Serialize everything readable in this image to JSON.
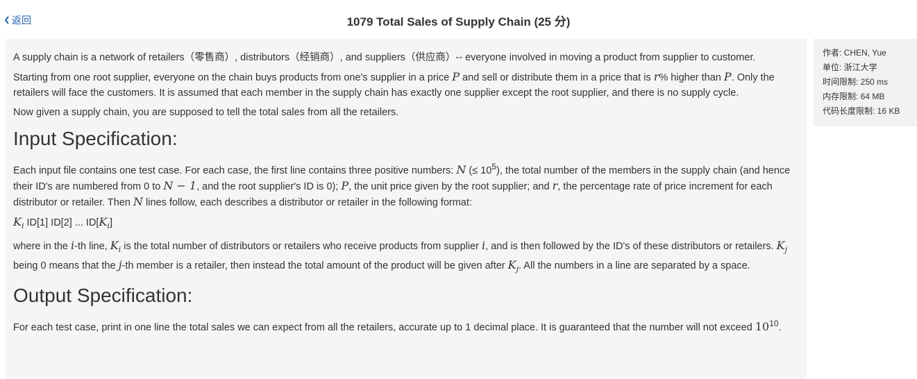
{
  "nav": {
    "back_label": "返回"
  },
  "page_title": "1079 Total Sales of Supply Chain (25 分)",
  "info": {
    "author": "作者: CHEN, Yue",
    "unit": "单位: 浙江大学",
    "time_limit": "时间限制: 250 ms",
    "memory_limit": "内存限制: 64 MB",
    "code_limit": "代码长度限制: 16 KB"
  },
  "problem": {
    "p1": "A supply chain is a network of retailers（零售商）, distributors（经销商）, and suppliers（供应商）-- everyone involved in moving a product from supplier to customer.",
    "p2_a": "Starting from one root supplier, everyone on the chain buys products from one's supplier in a price ",
    "sym_P": "P",
    "p2_b": " and sell or distribute them in a price that is ",
    "sym_r": "r",
    "p2_c": "% higher than ",
    "p2_d": ". Only the retailers will face the customers. It is assumed that each member in the supply chain has exactly one supplier except the root supplier, and there is no supply cycle.",
    "p3": "Now given a supply chain, you are supposed to tell the total sales from all the retailers.",
    "input_heading": "Input Specification:",
    "in1_a": "Each input file contains one test case. For each case, the first line contains three positive numbers: ",
    "sym_N": "N",
    "in1_le": "(≤ 10",
    "sup_5": "5",
    "in1_b": "), the total number of the members in the supply chain (and hence their ID's are numbered from 0 to ",
    "sym_N1": "N − 1",
    "in1_c": ", and the root supplier's ID is 0); ",
    "in1_d": ", the unit price given by the root supplier; and ",
    "in1_e": ", the percentage rate of price increment for each distributor or retailer. Then ",
    "in1_f": " lines follow, each describes a distributor or retailer in the following format:",
    "sym_Ki": "K",
    "sub_i": "i",
    "fmt_ids": " ID[1] ID[2] ... ID[",
    "fmt_end": "]",
    "in2_a": "where in the ",
    "sym_i": "i",
    "in2_b": "-th line, ",
    "in2_c": " is the total number of distributors or retailers who receive products from supplier ",
    "in2_d": ", and is then followed by the ID's of these distributors or retailers. ",
    "sub_j": "j",
    "in2_e": " being 0 means that the ",
    "sym_j": "j",
    "in2_f": "-th member is a retailer, then instead the total amount of the product will be given after ",
    "in2_g": ". All the numbers in a line are separated by a space.",
    "output_heading": "Output Specification:",
    "out1": "For each test case, print in one line the total sales we can expect from all the retailers, accurate up to 1 decimal place. It is guaranteed that the number will not exceed ",
    "base10": "10",
    "sup_10": "10",
    "out_end": "."
  }
}
